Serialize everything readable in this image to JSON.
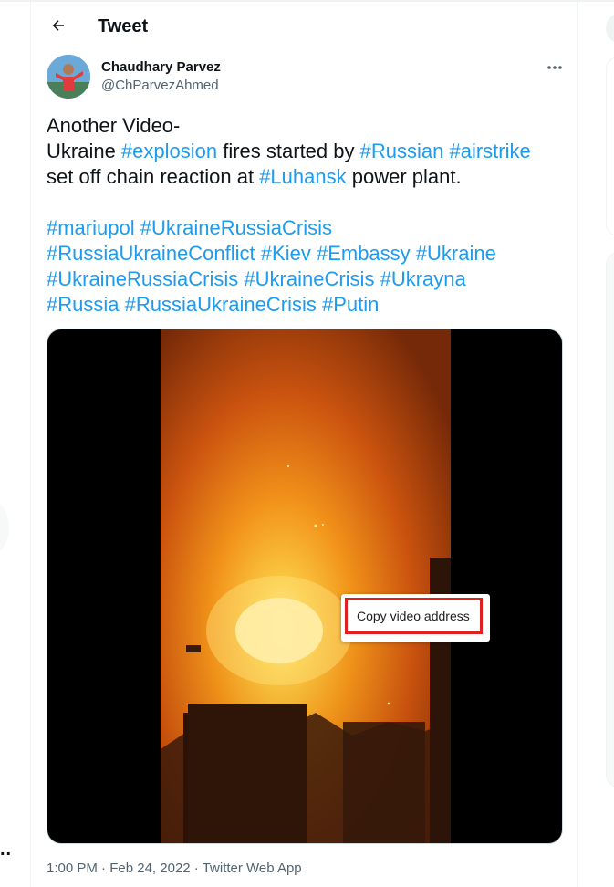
{
  "header": {
    "title": "Tweet"
  },
  "author": {
    "name": "Chaudhary Parvez",
    "handle": "@ChParvezAhmed"
  },
  "tweet": {
    "lines": [
      [
        {
          "t": "Another Video-",
          "tag": false
        }
      ],
      [
        {
          "t": "Ukraine ",
          "tag": false
        },
        {
          "t": "#explosion",
          "tag": true
        },
        {
          "t": " fires started by ",
          "tag": false
        },
        {
          "t": "#Russian",
          "tag": true
        },
        {
          "t": " ",
          "tag": false
        },
        {
          "t": "#airstrike",
          "tag": true
        }
      ],
      [
        {
          "t": "set off chain reaction at ",
          "tag": false
        },
        {
          "t": "#Luhansk",
          "tag": true
        },
        {
          "t": " power plant.",
          "tag": false
        }
      ],
      [],
      [
        {
          "t": "#mariupol",
          "tag": true
        },
        {
          "t": "  ",
          "tag": false
        },
        {
          "t": "#UkraineRussiaCrisis",
          "tag": true
        }
      ],
      [
        {
          "t": "#RussiaUkraineConflict",
          "tag": true
        },
        {
          "t": " ",
          "tag": false
        },
        {
          "t": "#Kiev",
          "tag": true
        },
        {
          "t": " ",
          "tag": false
        },
        {
          "t": "#Embassy",
          "tag": true
        },
        {
          "t": " ",
          "tag": false
        },
        {
          "t": "#Ukraine",
          "tag": true
        }
      ],
      [
        {
          "t": "#UkraineRussiaCrisis",
          "tag": true
        },
        {
          "t": " ",
          "tag": false
        },
        {
          "t": "#UkraineCrisis",
          "tag": true
        },
        {
          "t": " ",
          "tag": false
        },
        {
          "t": "#Ukrayna",
          "tag": true
        }
      ],
      [
        {
          "t": "#Russia",
          "tag": true
        },
        {
          "t": " ",
          "tag": false
        },
        {
          "t": "#RussiaUkraineCrisis",
          "tag": true
        },
        {
          "t": " ",
          "tag": false
        },
        {
          "t": "#Putin",
          "tag": true
        }
      ]
    ]
  },
  "context_menu": {
    "item": "Copy video address"
  },
  "timestamp": {
    "time": "1:00 PM",
    "sep1": " · ",
    "date": "Feb 24, 2022",
    "sep2": " · ",
    "source": "Twitter Web App"
  },
  "left_overflow": "..",
  "colors": {
    "link": "#1d9bf0",
    "text": "#0f1419",
    "muted": "#536471",
    "highlight": "#e02020"
  },
  "icons": [
    "back-arrow-icon",
    "more-dots-icon"
  ]
}
